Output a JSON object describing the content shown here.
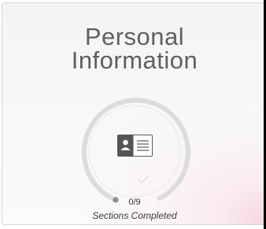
{
  "card": {
    "title_line1": "Personal",
    "title_line2": "Information",
    "progress": {
      "completed": 0,
      "total": 9,
      "fraction": 0.0,
      "count_text": "0/9"
    },
    "subtitle": "Sections Completed",
    "icon_name": "id-card-icon",
    "check_icon_name": "checkmark-icon"
  },
  "colors": {
    "title": "#5f5f5f",
    "ring_track": "#d9d9d9",
    "ring_progress": "#8c8c8c",
    "icon_dark": "#555555"
  }
}
